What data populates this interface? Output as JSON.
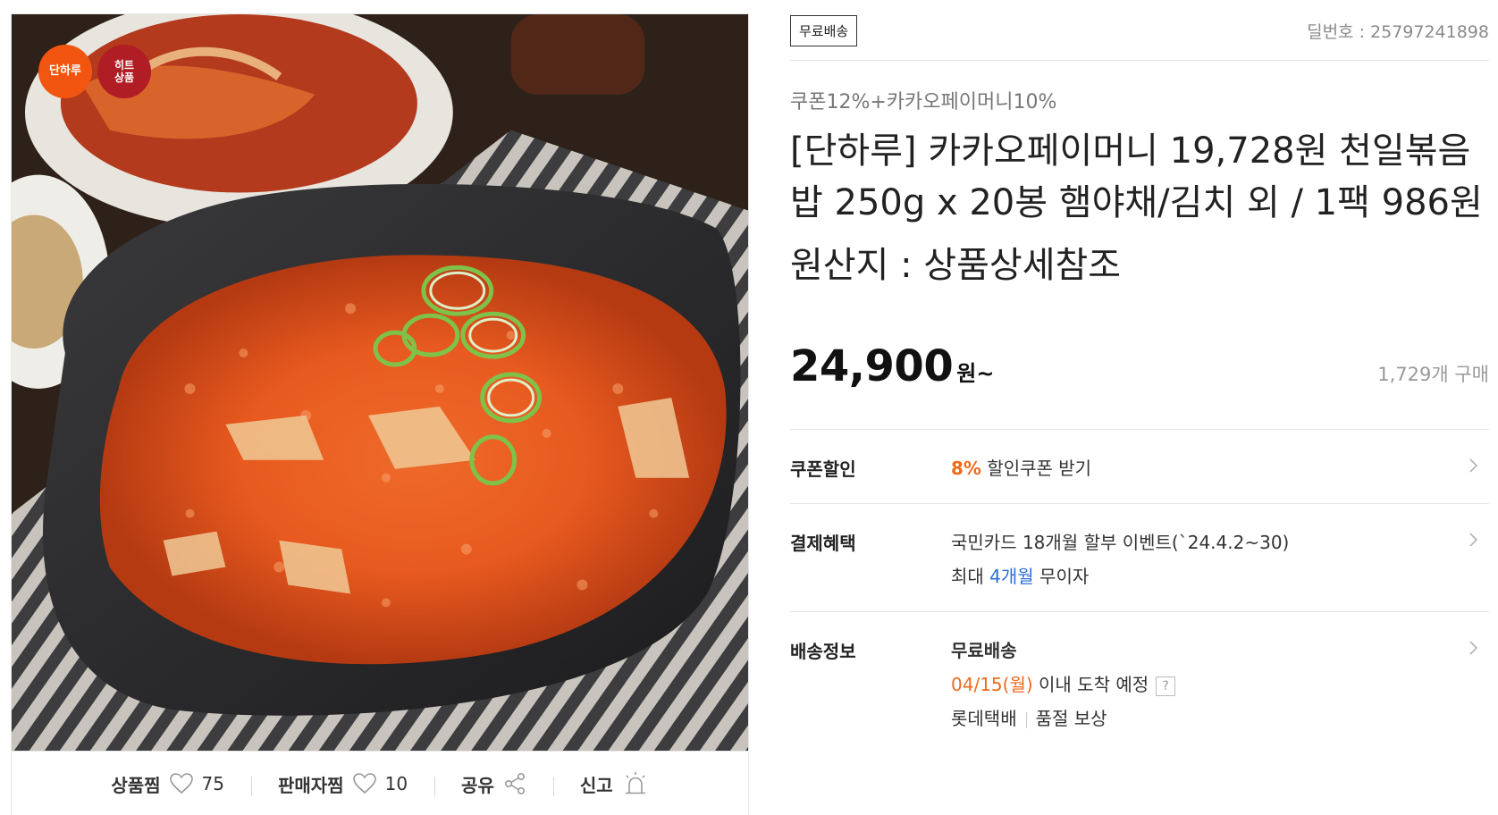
{
  "image": {
    "badge_danharu": "단하루",
    "badge_hit": "히트\n상품"
  },
  "action_bar": {
    "product_wish_label": "상품찜",
    "product_wish_count": "75",
    "seller_wish_label": "판매자찜",
    "seller_wish_count": "10",
    "share_label": "공유",
    "report_label": "신고"
  },
  "header": {
    "free_shipping_tag": "무료배송",
    "deal_number": "딜번호 : 25797241898"
  },
  "product": {
    "coupon_info": "쿠폰12%+카카오페이머니10%",
    "title": "[단하루] 카카오페이머니 19,728원 천일볶음밥 250g x 20봉 햄야채/김치 외 / 1팩 986원",
    "origin": "원산지 : 상품상세참조",
    "price": "24,900",
    "price_unit": "원~",
    "purchase_count": "1,729개 구매"
  },
  "rows": {
    "coupon": {
      "label": "쿠폰할인",
      "percent": "8%",
      "text": "할인쿠폰 받기"
    },
    "payment": {
      "label": "결제혜택",
      "line1": "국민카드 18개월 할부 이벤트(`24.4.2~30)",
      "line2_prefix": "최대 ",
      "line2_highlight": "4개월",
      "line2_suffix": " 무이자"
    },
    "shipping": {
      "label": "배송정보",
      "title": "무료배송",
      "date": "04/15(월)",
      "date_suffix": " 이내 도착 예정",
      "help": "?",
      "carrier": "롯데택배",
      "compensation": "품절 보상"
    }
  },
  "colors": {
    "accent_orange": "#f06a1a",
    "accent_blue": "#2b6fd6",
    "badge_danharu": "#f2550f",
    "badge_hit": "#b11d24"
  }
}
